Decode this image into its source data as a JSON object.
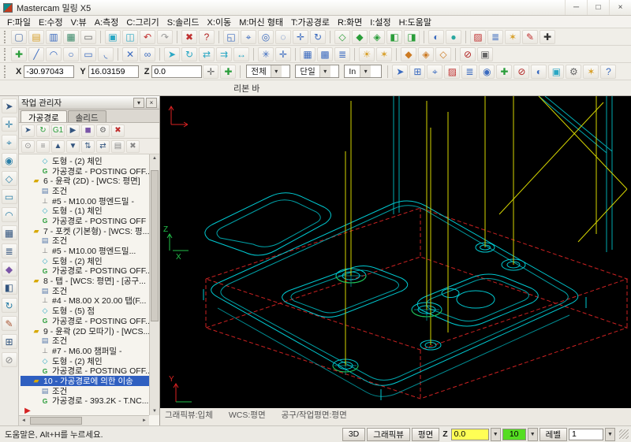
{
  "window": {
    "title": "Mastercam 밀링 X5",
    "minimize": "─",
    "maximize": "□",
    "close": "×"
  },
  "menu": {
    "items": [
      "F:파일",
      "E:수정",
      "V:뷰",
      "A:측정",
      "C:그리기",
      "S:솔리드",
      "X:이동",
      "M:머신 형태",
      "T:가공경로",
      "R:화면",
      "I:설정",
      "H:도움말"
    ]
  },
  "toolbar1": {
    "items": [
      {
        "n": "new-file",
        "g": "▢",
        "c": "#4a6da8"
      },
      {
        "n": "open-file",
        "g": "▤",
        "c": "#d8a02a"
      },
      {
        "n": "save-file",
        "g": "▥",
        "c": "#3a6abf"
      },
      {
        "n": "export-file",
        "g": "▦",
        "c": "#3a8a6a"
      },
      {
        "n": "print",
        "g": "▭",
        "c": "#666666"
      },
      {
        "sep": true
      },
      {
        "n": "screen-capture",
        "g": "▣",
        "c": "#2aa7c4"
      },
      {
        "n": "screen-monitor",
        "g": "◫",
        "c": "#2aa7c4"
      },
      {
        "n": "undo",
        "g": "↶",
        "c": "#c03030"
      },
      {
        "n": "redo",
        "g": "↷",
        "c": "#999999"
      },
      {
        "sep": true
      },
      {
        "n": "delete-entity",
        "g": "✖",
        "c": "#c03030"
      },
      {
        "n": "analyze-entity",
        "g": "?",
        "c": "#b02020"
      },
      {
        "sep": true
      },
      {
        "n": "zoom-window",
        "g": "◱",
        "c": "#3a6abf"
      },
      {
        "n": "zoom-target",
        "g": "⌖",
        "c": "#3a6abf"
      },
      {
        "n": "zoom-dynamic",
        "g": "◎",
        "c": "#3a6abf"
      },
      {
        "n": "unzoom",
        "g": "◌",
        "c": "#3a6abf"
      },
      {
        "n": "pan",
        "g": "✛",
        "c": "#3a6abf"
      },
      {
        "n": "repaint",
        "g": "↻",
        "c": "#3a6abf"
      },
      {
        "sep": true
      },
      {
        "n": "gview-wireframe",
        "g": "◇",
        "c": "#2a9d3a"
      },
      {
        "n": "gview-shaded",
        "g": "◆",
        "c": "#2a9d3a"
      },
      {
        "n": "gview-iso",
        "g": "◈",
        "c": "#2a9d3a"
      },
      {
        "n": "gview-top",
        "g": "◧",
        "c": "#2a9d3a"
      },
      {
        "n": "gview-front",
        "g": "◨",
        "c": "#2a9d3a"
      },
      {
        "sep": true
      },
      {
        "n": "rotate-view",
        "g": "◐",
        "c": "#3a6abf"
      },
      {
        "n": "view-sphere",
        "g": "●",
        "c": "#2aa7a0"
      },
      {
        "sep": true
      },
      {
        "n": "attr-color",
        "g": "▨",
        "c": "#c03030"
      },
      {
        "n": "attr-level",
        "g": "≣",
        "c": "#3a6abf"
      },
      {
        "n": "attr-point-style",
        "g": "✶",
        "c": "#d8a02a"
      },
      {
        "n": "attr-line-style",
        "g": "✎",
        "c": "#c03030"
      },
      {
        "n": "attr-width",
        "g": "✚",
        "c": "#333333"
      }
    ]
  },
  "toolbar2": {
    "items": [
      {
        "n": "create-point",
        "g": "✚",
        "c": "#2a9d3a"
      },
      {
        "n": "create-line",
        "g": "╱",
        "c": "#3a6abf"
      },
      {
        "n": "create-arc",
        "g": "◠",
        "c": "#3a6abf"
      },
      {
        "n": "create-circle",
        "g": "○",
        "c": "#3a6abf"
      },
      {
        "n": "create-rect",
        "g": "▭",
        "c": "#3a6abf"
      },
      {
        "n": "create-fillet",
        "g": "◟",
        "c": "#3a6abf"
      },
      {
        "sep": true
      },
      {
        "n": "trim",
        "g": "✕",
        "c": "#3a6abf"
      },
      {
        "n": "join",
        "g": "∞",
        "c": "#3a6abf"
      },
      {
        "sep": true
      },
      {
        "n": "xform-move",
        "g": "➤",
        "c": "#2aa7c4"
      },
      {
        "n": "xform-rotate",
        "g": "↻",
        "c": "#2aa7c4"
      },
      {
        "n": "xform-mirror",
        "g": "⇄",
        "c": "#2aa7c4"
      },
      {
        "n": "xform-offset",
        "g": "⇉",
        "c": "#2aa7c4"
      },
      {
        "n": "xform-scale",
        "g": "↔",
        "c": "#2aa7c4"
      },
      {
        "sep": true
      },
      {
        "n": "snap-grid",
        "g": "✳",
        "c": "#3a6abf"
      },
      {
        "n": "autocursor",
        "g": "✛",
        "c": "#3a6abf"
      },
      {
        "sep": true
      },
      {
        "n": "pattern-grid",
        "g": "▦",
        "c": "#3a6abf"
      },
      {
        "n": "pattern-array",
        "g": "▩",
        "c": "#3a6abf"
      },
      {
        "n": "levels-manager",
        "g": "≣",
        "c": "#3a6abf"
      },
      {
        "sep": true
      },
      {
        "n": "material",
        "g": "☀",
        "c": "#d8a02a"
      },
      {
        "n": "light",
        "g": "✶",
        "c": "#d8a02a"
      },
      {
        "sep": true
      },
      {
        "n": "solid-extrude",
        "g": "◆",
        "c": "#cc7a22"
      },
      {
        "n": "solid-cut",
        "g": "◈",
        "c": "#cc7a22"
      },
      {
        "n": "solid-shell",
        "g": "◇",
        "c": "#cc7a22"
      },
      {
        "sep": true
      },
      {
        "n": "toolpath-off",
        "g": "⊘",
        "c": "#b02020"
      },
      {
        "n": "machine-sim",
        "g": "▣",
        "c": "#666666"
      }
    ]
  },
  "coordbar": {
    "x_label": "X",
    "x_value": "-30.97043",
    "y_label": "Y",
    "y_value": "16.03159",
    "z_label": "Z",
    "z_value": "0.0",
    "select_mode": "전체",
    "mask_mode": "단일",
    "units": "In",
    "icons_a": [
      {
        "n": "point-position",
        "g": "✛",
        "c": "#666666"
      },
      {
        "n": "fastpoint",
        "g": "✚",
        "c": "#2a9d3a"
      }
    ],
    "icons_b": [
      {
        "n": "select-pointer",
        "g": "➤",
        "c": "#3a6abf"
      },
      {
        "n": "select-window",
        "g": "⊞",
        "c": "#3a6abf"
      },
      {
        "n": "select-polygon",
        "g": "⌖",
        "c": "#3a6abf"
      },
      {
        "n": "select-color",
        "g": "▨",
        "c": "#c03030"
      },
      {
        "n": "select-level",
        "g": "≣",
        "c": "#3a6abf"
      },
      {
        "n": "select-entities",
        "g": "◉",
        "c": "#3a6abf"
      },
      {
        "n": "select-result",
        "g": "✚",
        "c": "#2a9d3a"
      },
      {
        "n": "select-none",
        "g": "⊘",
        "c": "#b02020"
      },
      {
        "n": "select-last",
        "g": "◐",
        "c": "#3a6abf"
      },
      {
        "n": "select-all-button",
        "g": "▣",
        "c": "#2aa7c4"
      },
      {
        "n": "gear-settings",
        "g": "⚙",
        "c": "#666666"
      },
      {
        "n": "select-validate",
        "g": "✶",
        "c": "#d8a02a"
      },
      {
        "n": "select-help",
        "g": "?",
        "c": "#3a6abf"
      }
    ]
  },
  "ribbon": {
    "label": "리본 바"
  },
  "left_strip": {
    "items": [
      {
        "n": "select-arrow",
        "g": "➤",
        "c": "#33557f"
      },
      {
        "n": "analyze-distance",
        "g": "✛",
        "c": "#2a7fa8"
      },
      {
        "n": "sketch-point",
        "g": "⌖",
        "c": "#2a7fa8"
      },
      {
        "n": "sketch-circle",
        "g": "◉",
        "c": "#2a7fa8"
      },
      {
        "n": "sketch-polygon",
        "g": "◇",
        "c": "#2a7fa8"
      },
      {
        "n": "sketch-rect",
        "g": "▭",
        "c": "#2a7fa8"
      },
      {
        "n": "sketch-arc",
        "g": "◠",
        "c": "#2a7fa8"
      },
      {
        "n": "pattern-tool",
        "g": "▦",
        "c": "#33557f"
      },
      {
        "n": "levels-tool",
        "g": "≣",
        "c": "#33557f"
      },
      {
        "n": "solids-tool",
        "g": "◆",
        "c": "#7a55a8"
      },
      {
        "n": "plane-tool",
        "g": "◧",
        "c": "#33557f"
      },
      {
        "n": "rotate-tool",
        "g": "↻",
        "c": "#2a7fa8"
      },
      {
        "n": "draft-tool",
        "g": "✎",
        "c": "#a85533"
      },
      {
        "n": "grid-tool",
        "g": "⊞",
        "c": "#33557f"
      },
      {
        "n": "disable-tool",
        "g": "⊘",
        "c": "#888888"
      }
    ]
  },
  "panel": {
    "title": "작업 관리자",
    "tabs": [
      {
        "label": "가공경로"
      },
      {
        "label": "솔리드"
      }
    ],
    "toolbar_row1": [
      {
        "n": "select-all-ops",
        "g": "➤",
        "c": "#33557f"
      },
      {
        "n": "regen-all",
        "g": "↻",
        "c": "#2a9d3a"
      },
      {
        "n": "post-g1",
        "g": "G1",
        "c": "#2a9d3a"
      },
      {
        "n": "backplot",
        "g": "▶",
        "c": "#33557f"
      },
      {
        "n": "verify",
        "g": "◼",
        "c": "#7a55a8"
      },
      {
        "n": "op-options",
        "g": "⚙",
        "c": "#666666"
      },
      {
        "n": "delete-op",
        "g": "✖",
        "c": "#c03030"
      }
    ],
    "toolbar_row2": [
      {
        "n": "lock-op",
        "g": "⊙",
        "c": "#888888"
      },
      {
        "n": "toggle-toolpath-display",
        "g": "≡",
        "c": "#888888"
      },
      {
        "n": "move-up",
        "g": "▲",
        "c": "#33557f"
      },
      {
        "n": "move-down",
        "g": "▼",
        "c": "#33557f"
      },
      {
        "n": "move-insert",
        "g": "⇅",
        "c": "#33557f"
      },
      {
        "n": "scroll-ops",
        "g": "⇄",
        "c": "#33557f"
      },
      {
        "n": "display-options",
        "g": "▤",
        "c": "#888888"
      },
      {
        "n": "remove-op",
        "g": "✖",
        "c": "#888888"
      }
    ],
    "tree": [
      {
        "lvl": 2,
        "icon": "geom",
        "label": "도형 - (2) 체인"
      },
      {
        "lvl": 2,
        "icon": "tp",
        "label": "가공경로 - POSTING OFF..."
      },
      {
        "lvl": 1,
        "icon": "op",
        "label": "6 - 윤곽 (2D) - [WCS: 평면]"
      },
      {
        "lvl": 2,
        "icon": "cond",
        "label": "조건"
      },
      {
        "lvl": 2,
        "icon": "tool",
        "label": "#5 - M10.00 평엔드밀 -"
      },
      {
        "lvl": 2,
        "icon": "geom",
        "label": "도형 - (1) 체인"
      },
      {
        "lvl": 2,
        "icon": "tp",
        "label": "가공경로 - POSTING OFF"
      },
      {
        "lvl": 1,
        "icon": "op",
        "label": "7 - 포켓 (기본형) - [WCS: 평..."
      },
      {
        "lvl": 2,
        "icon": "cond",
        "label": "조건"
      },
      {
        "lvl": 2,
        "icon": "tool",
        "label": "#5 - M10.00 평엔드밀..."
      },
      {
        "lvl": 2,
        "icon": "geom",
        "label": "도형 - (2) 체인"
      },
      {
        "lvl": 2,
        "icon": "tp",
        "label": "가공경로 - POSTING OFF..."
      },
      {
        "lvl": 1,
        "icon": "op",
        "label": "8 - 탭 - [WCS: 평면] - [공구..."
      },
      {
        "lvl": 2,
        "icon": "cond",
        "label": "조건"
      },
      {
        "lvl": 2,
        "icon": "tool",
        "label": "#4 - M8.00 X 20.00 탭(F..."
      },
      {
        "lvl": 2,
        "icon": "geom",
        "label": "도형 - (5) 점"
      },
      {
        "lvl": 2,
        "icon": "tp",
        "label": "가공경로 - POSTING OFF..."
      },
      {
        "lvl": 1,
        "icon": "op",
        "label": "9 - 윤곽 (2D 모따기) - [WCS..."
      },
      {
        "lvl": 2,
        "icon": "cond",
        "label": "조건"
      },
      {
        "lvl": 2,
        "icon": "tool",
        "label": "#7 - M6.00 챔퍼밀 -"
      },
      {
        "lvl": 2,
        "icon": "geom",
        "label": "도형 - (2) 체인"
      },
      {
        "lvl": 2,
        "icon": "tp",
        "label": "가공경로 - POSTING OFF..."
      },
      {
        "lvl": 1,
        "icon": "op",
        "label": "10 - 가공경로에 의한 이송",
        "sel": true
      },
      {
        "lvl": 2,
        "icon": "cond",
        "label": "조건"
      },
      {
        "lvl": 2,
        "icon": "tp",
        "label": "가공경로 - 393.2K - T.NC..."
      },
      {
        "lvl": 0,
        "icon": "marker",
        "label": ""
      }
    ]
  },
  "viewport": {
    "status": {
      "gview": "그래픽뷰:입체",
      "wcs": "WCS:평면",
      "tplane": "공구/작업평면:평면"
    },
    "axes": {
      "mid_z": "Z",
      "mid_x": "X",
      "bottom_y": "Y"
    }
  },
  "statusbar": {
    "help_text": "도움말은, Alt+H를 누르세요.",
    "view_3d": "3D",
    "gview_btn": "그래픽뷰",
    "plane_btn": "평면",
    "z_label": "Z",
    "z_value": "0.0",
    "level_color_value": "10",
    "level_btn": "레벨",
    "level_value": "1"
  },
  "colors": {
    "selection": "#2f5fc0",
    "wireframe": "#00c8d0",
    "rapid": "#d6d600",
    "stock_box": "#cc2222",
    "lead": "#22c04a",
    "z_field": "#ffff55",
    "level_field": "#55dd22"
  }
}
